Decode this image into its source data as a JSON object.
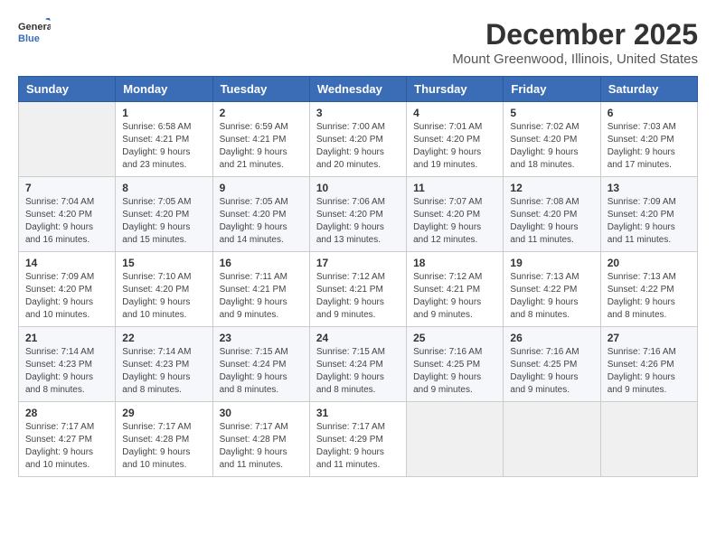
{
  "header": {
    "logo_line1": "General",
    "logo_line2": "Blue",
    "month_title": "December 2025",
    "location": "Mount Greenwood, Illinois, United States"
  },
  "columns": [
    "Sunday",
    "Monday",
    "Tuesday",
    "Wednesday",
    "Thursday",
    "Friday",
    "Saturday"
  ],
  "weeks": [
    [
      {
        "day": "",
        "empty": true
      },
      {
        "day": "1",
        "sunrise": "Sunrise: 6:58 AM",
        "sunset": "Sunset: 4:21 PM",
        "daylight": "Daylight: 9 hours and 23 minutes."
      },
      {
        "day": "2",
        "sunrise": "Sunrise: 6:59 AM",
        "sunset": "Sunset: 4:21 PM",
        "daylight": "Daylight: 9 hours and 21 minutes."
      },
      {
        "day": "3",
        "sunrise": "Sunrise: 7:00 AM",
        "sunset": "Sunset: 4:20 PM",
        "daylight": "Daylight: 9 hours and 20 minutes."
      },
      {
        "day": "4",
        "sunrise": "Sunrise: 7:01 AM",
        "sunset": "Sunset: 4:20 PM",
        "daylight": "Daylight: 9 hours and 19 minutes."
      },
      {
        "day": "5",
        "sunrise": "Sunrise: 7:02 AM",
        "sunset": "Sunset: 4:20 PM",
        "daylight": "Daylight: 9 hours and 18 minutes."
      },
      {
        "day": "6",
        "sunrise": "Sunrise: 7:03 AM",
        "sunset": "Sunset: 4:20 PM",
        "daylight": "Daylight: 9 hours and 17 minutes."
      }
    ],
    [
      {
        "day": "7",
        "sunrise": "Sunrise: 7:04 AM",
        "sunset": "Sunset: 4:20 PM",
        "daylight": "Daylight: 9 hours and 16 minutes."
      },
      {
        "day": "8",
        "sunrise": "Sunrise: 7:05 AM",
        "sunset": "Sunset: 4:20 PM",
        "daylight": "Daylight: 9 hours and 15 minutes."
      },
      {
        "day": "9",
        "sunrise": "Sunrise: 7:05 AM",
        "sunset": "Sunset: 4:20 PM",
        "daylight": "Daylight: 9 hours and 14 minutes."
      },
      {
        "day": "10",
        "sunrise": "Sunrise: 7:06 AM",
        "sunset": "Sunset: 4:20 PM",
        "daylight": "Daylight: 9 hours and 13 minutes."
      },
      {
        "day": "11",
        "sunrise": "Sunrise: 7:07 AM",
        "sunset": "Sunset: 4:20 PM",
        "daylight": "Daylight: 9 hours and 12 minutes."
      },
      {
        "day": "12",
        "sunrise": "Sunrise: 7:08 AM",
        "sunset": "Sunset: 4:20 PM",
        "daylight": "Daylight: 9 hours and 11 minutes."
      },
      {
        "day": "13",
        "sunrise": "Sunrise: 7:09 AM",
        "sunset": "Sunset: 4:20 PM",
        "daylight": "Daylight: 9 hours and 11 minutes."
      }
    ],
    [
      {
        "day": "14",
        "sunrise": "Sunrise: 7:09 AM",
        "sunset": "Sunset: 4:20 PM",
        "daylight": "Daylight: 9 hours and 10 minutes."
      },
      {
        "day": "15",
        "sunrise": "Sunrise: 7:10 AM",
        "sunset": "Sunset: 4:20 PM",
        "daylight": "Daylight: 9 hours and 10 minutes."
      },
      {
        "day": "16",
        "sunrise": "Sunrise: 7:11 AM",
        "sunset": "Sunset: 4:21 PM",
        "daylight": "Daylight: 9 hours and 9 minutes."
      },
      {
        "day": "17",
        "sunrise": "Sunrise: 7:12 AM",
        "sunset": "Sunset: 4:21 PM",
        "daylight": "Daylight: 9 hours and 9 minutes."
      },
      {
        "day": "18",
        "sunrise": "Sunrise: 7:12 AM",
        "sunset": "Sunset: 4:21 PM",
        "daylight": "Daylight: 9 hours and 9 minutes."
      },
      {
        "day": "19",
        "sunrise": "Sunrise: 7:13 AM",
        "sunset": "Sunset: 4:22 PM",
        "daylight": "Daylight: 9 hours and 8 minutes."
      },
      {
        "day": "20",
        "sunrise": "Sunrise: 7:13 AM",
        "sunset": "Sunset: 4:22 PM",
        "daylight": "Daylight: 9 hours and 8 minutes."
      }
    ],
    [
      {
        "day": "21",
        "sunrise": "Sunrise: 7:14 AM",
        "sunset": "Sunset: 4:23 PM",
        "daylight": "Daylight: 9 hours and 8 minutes."
      },
      {
        "day": "22",
        "sunrise": "Sunrise: 7:14 AM",
        "sunset": "Sunset: 4:23 PM",
        "daylight": "Daylight: 9 hours and 8 minutes."
      },
      {
        "day": "23",
        "sunrise": "Sunrise: 7:15 AM",
        "sunset": "Sunset: 4:24 PM",
        "daylight": "Daylight: 9 hours and 8 minutes."
      },
      {
        "day": "24",
        "sunrise": "Sunrise: 7:15 AM",
        "sunset": "Sunset: 4:24 PM",
        "daylight": "Daylight: 9 hours and 8 minutes."
      },
      {
        "day": "25",
        "sunrise": "Sunrise: 7:16 AM",
        "sunset": "Sunset: 4:25 PM",
        "daylight": "Daylight: 9 hours and 9 minutes."
      },
      {
        "day": "26",
        "sunrise": "Sunrise: 7:16 AM",
        "sunset": "Sunset: 4:25 PM",
        "daylight": "Daylight: 9 hours and 9 minutes."
      },
      {
        "day": "27",
        "sunrise": "Sunrise: 7:16 AM",
        "sunset": "Sunset: 4:26 PM",
        "daylight": "Daylight: 9 hours and 9 minutes."
      }
    ],
    [
      {
        "day": "28",
        "sunrise": "Sunrise: 7:17 AM",
        "sunset": "Sunset: 4:27 PM",
        "daylight": "Daylight: 9 hours and 10 minutes."
      },
      {
        "day": "29",
        "sunrise": "Sunrise: 7:17 AM",
        "sunset": "Sunset: 4:28 PM",
        "daylight": "Daylight: 9 hours and 10 minutes."
      },
      {
        "day": "30",
        "sunrise": "Sunrise: 7:17 AM",
        "sunset": "Sunset: 4:28 PM",
        "daylight": "Daylight: 9 hours and 11 minutes."
      },
      {
        "day": "31",
        "sunrise": "Sunrise: 7:17 AM",
        "sunset": "Sunset: 4:29 PM",
        "daylight": "Daylight: 9 hours and 11 minutes."
      },
      {
        "day": "",
        "empty": true
      },
      {
        "day": "",
        "empty": true
      },
      {
        "day": "",
        "empty": true
      }
    ]
  ]
}
